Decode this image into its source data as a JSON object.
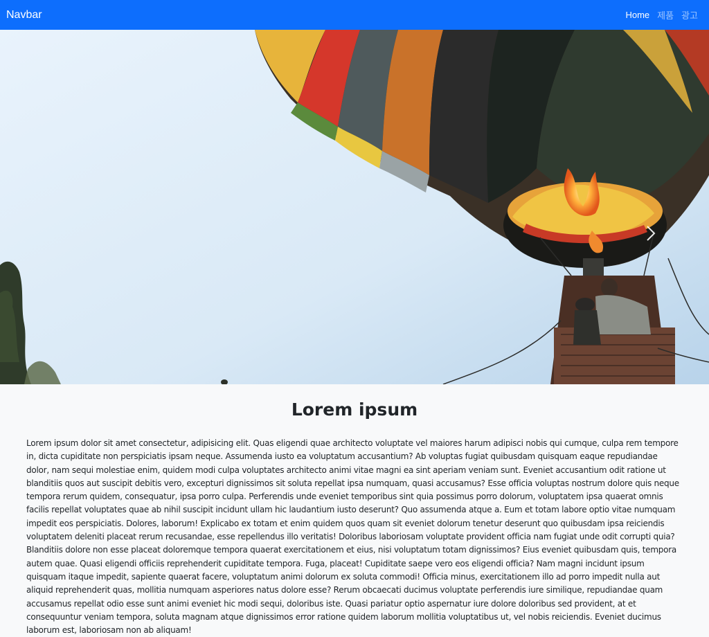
{
  "navbar": {
    "brand": "Navbar",
    "links": [
      {
        "label": "Home",
        "active": true
      },
      {
        "label": "제품",
        "active": false
      },
      {
        "label": "광고",
        "active": false
      }
    ],
    "background_color": "#0d6efd"
  },
  "hero": {
    "image_subject": "hot-air-balloon-photo",
    "next_control_icon": "chevron-right-icon"
  },
  "content": {
    "heading": "Lorem ipsum",
    "body": "Lorem ipsum dolor sit amet consectetur, adipisicing elit. Quas eligendi quae architecto voluptate vel maiores harum adipisci nobis qui cumque, culpa rem tempore in, dicta cupiditate non perspiciatis ipsam neque. Assumenda iusto ea voluptatum accusantium? Ab voluptas fugiat quibusdam quisquam eaque repudiandae dolor, nam sequi molestiae enim, quidem modi culpa voluptates architecto animi vitae magni ea sint aperiam veniam sunt. Eveniet accusantium odit ratione ut blanditiis quos aut suscipit debitis vero, excepturi dignissimos sit soluta repellat ipsa numquam, quasi accusamus? Esse officia voluptas nostrum dolore quis neque tempora rerum quidem, consequatur, ipsa porro culpa. Perferendis unde eveniet temporibus sint quia possimus porro dolorum, voluptatem ipsa quaerat omnis facilis repellat voluptates quae ab nihil suscipit incidunt ullam hic laudantium iusto deserunt? Quo assumenda atque a. Eum et totam labore optio vitae numquam impedit eos perspiciatis. Dolores, laborum! Explicabo ex totam et enim quidem quos quam sit eveniet dolorum tenetur deserunt quo quibusdam ipsa reiciendis voluptatem deleniti placeat rerum recusandae, esse repellendus illo veritatis! Doloribus laboriosam voluptate provident officia nam fugiat unde odit corrupti quia? Blanditiis dolore non esse placeat doloremque tempora quaerat exercitationem et eius, nisi voluptatum totam dignissimos? Eius eveniet quibusdam quis, tempora autem quae. Quasi eligendi officiis reprehenderit cupiditate tempora. Fuga, placeat! Cupiditate saepe vero eos eligendi officia? Nam magni incidunt ipsum quisquam itaque impedit, sapiente quaerat facere, voluptatum animi dolorum ex soluta commodi! Officia minus, exercitationem illo ad porro impedit nulla aut aliquid reprehenderit quas, mollitia numquam asperiores natus dolore esse? Rerum obcaecati ducimus voluptate perferendis iure similique, repudiandae quam accusamus repellat odio esse sunt animi eveniet hic modi sequi, doloribus iste. Quasi pariatur optio aspernatur iure dolore doloribus sed provident, at et consequuntur veniam tempora, soluta magnam atque dignissimos error ratione quidem laborum mollitia voluptatibus ut, vel nobis reiciendis. Eveniet ducimus laborum est, laboriosam non ab aliquam!"
  }
}
